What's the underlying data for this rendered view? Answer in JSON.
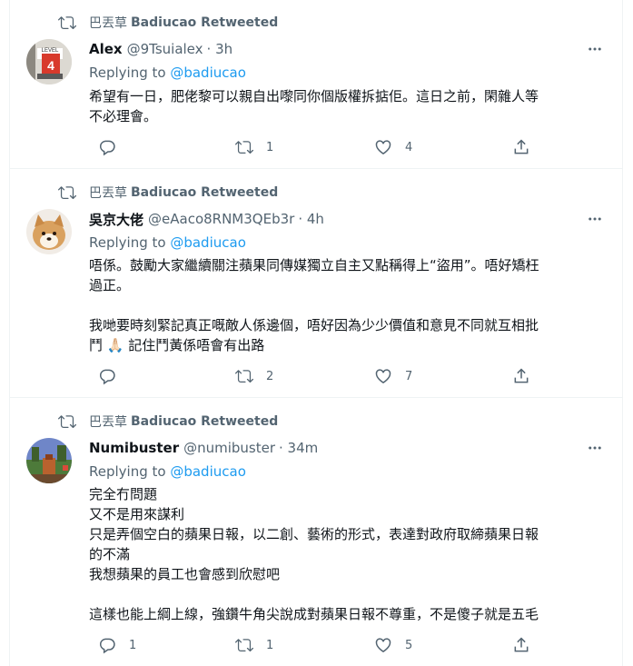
{
  "tweets": [
    {
      "retweeted_by": "巴丟草",
      "retweeted_label": "Badiucao Retweeted",
      "author": "Alex",
      "handle": "@9Tsuialex",
      "time": "· 3h",
      "replying_prefix": "Replying to ",
      "replying_to": "@badiucao",
      "body": [
        "希望有一日，肥佬黎可以親自出嚟同你個版權拆掂佢。這日之前，閑雜人等",
        "不必理會。"
      ],
      "replies": "",
      "retweets": "1",
      "likes": "4"
    },
    {
      "retweeted_by": "巴丟草",
      "retweeted_label": "Badiucao Retweeted",
      "author": "吳京大佬",
      "handle": "@eAaco8RNM3QEb3r",
      "time": "· 4h",
      "replying_prefix": "Replying to ",
      "replying_to": "@badiucao",
      "body": [
        "唔係。鼓勵大家繼續關注蘋果同傳媒獨立自主又點稱得上“盜用”。唔好矯枉",
        "過正。",
        "",
        "我哋要時刻緊記真正嘅敵人係邊個，唔好因為少少價值和意見不同就互相批",
        "鬥 🙏🏻 記住鬥黃係唔會有出路"
      ],
      "replies": "",
      "retweets": "2",
      "likes": "7"
    },
    {
      "retweeted_by": "巴丟草",
      "retweeted_label": "Badiucao Retweeted",
      "author": "Numibuster",
      "handle": "@numibuster",
      "time": "· 34m",
      "replying_prefix": "Replying to ",
      "replying_to": "@badiucao",
      "body": [
        "完全冇問題",
        "又不是用來謀利",
        "只是弄個空白的蘋果日報，以二創、藝術的形式，表達對政府取締蘋果日報",
        "的不滿",
        "我想蘋果的員工也會感到欣慰吧",
        "",
        "這樣也能上綱上線，強鑽牛角尖說成對蘋果日報不尊重，不是傻子就是五毛"
      ],
      "replies": "1",
      "retweets": "1",
      "likes": "5"
    }
  ],
  "avatar_badges": {
    "alex": "LEVEL",
    "alex_number": "4"
  },
  "colors": {
    "muted": "#536471",
    "link": "#1d9bf0",
    "text": "#0f1419",
    "border": "#eff3f4"
  },
  "icons": [
    "retweet-icon",
    "more-icon",
    "reply-icon",
    "like-icon",
    "share-icon"
  ]
}
